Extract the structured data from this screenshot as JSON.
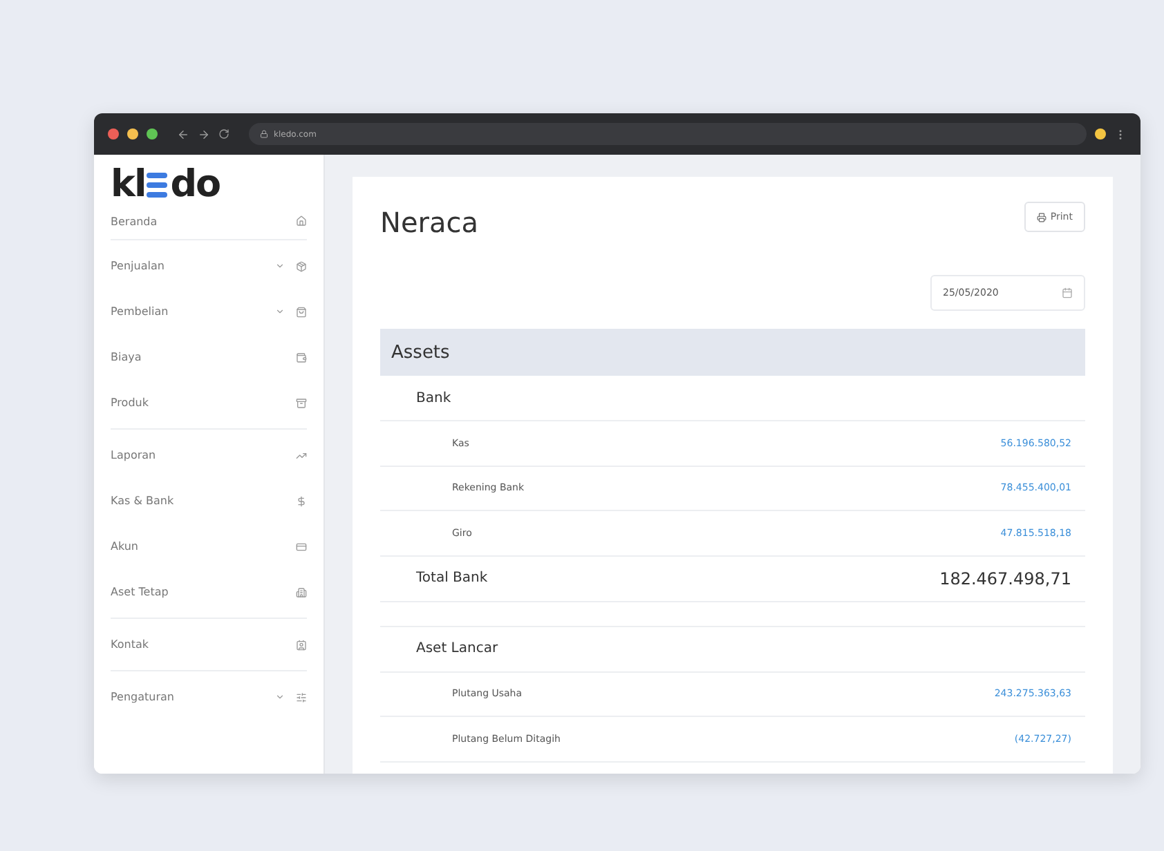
{
  "browser": {
    "url": "kledo.com"
  },
  "logo": {
    "before": "kl",
    "after": "do"
  },
  "sidebar": {
    "groups": [
      [
        {
          "label": "Beranda",
          "expandable": false
        }
      ],
      [
        {
          "label": "Penjualan",
          "expandable": true
        },
        {
          "label": "Pembelian",
          "expandable": true
        },
        {
          "label": "Biaya",
          "expandable": false
        },
        {
          "label": "Produk",
          "expandable": false
        }
      ],
      [
        {
          "label": "Laporan",
          "expandable": false
        },
        {
          "label": "Kas & Bank",
          "expandable": false
        },
        {
          "label": "Akun",
          "expandable": false
        },
        {
          "label": "Aset Tetap",
          "expandable": false
        }
      ],
      [
        {
          "label": "Kontak",
          "expandable": false
        }
      ],
      [
        {
          "label": "Pengaturan",
          "expandable": true
        }
      ]
    ]
  },
  "page": {
    "title": "Neraca",
    "print_button": "Print",
    "date": "25/05/2020"
  },
  "report": {
    "rows": [
      {
        "kind": "section",
        "label": "Assets"
      },
      {
        "kind": "group",
        "label": "Bank"
      },
      {
        "kind": "item",
        "label": "Kas",
        "amount": "56.196.580,52"
      },
      {
        "kind": "item",
        "label": "Rekening Bank",
        "amount": "78.455.400,01"
      },
      {
        "kind": "item",
        "label": "Giro",
        "amount": "47.815.518,18"
      },
      {
        "kind": "total",
        "label": "Total Bank",
        "amount": "182.467.498,71"
      },
      {
        "kind": "spacer"
      },
      {
        "kind": "group",
        "label": "Aset Lancar"
      },
      {
        "kind": "item",
        "label": "Plutang Usaha",
        "amount": "243.275.363,63"
      },
      {
        "kind": "item",
        "label": "Plutang Belum Ditagih",
        "amount": "(42.727,27)"
      }
    ]
  }
}
